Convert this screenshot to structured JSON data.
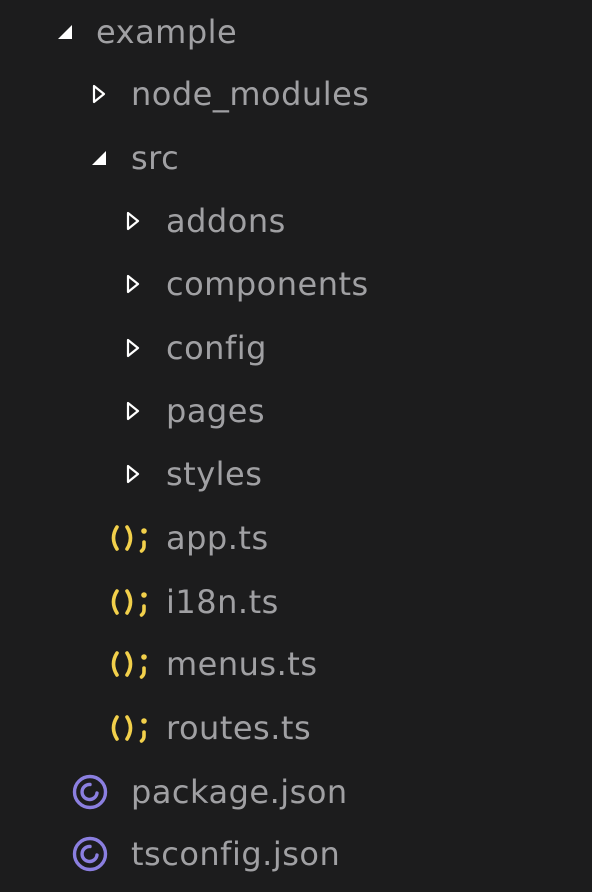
{
  "explorer": {
    "root": {
      "label": "example",
      "expanded": true
    },
    "node_modules": {
      "label": "node_modules",
      "expanded": false
    },
    "src": {
      "label": "src",
      "expanded": true,
      "folders": [
        {
          "label": "addons",
          "expanded": false
        },
        {
          "label": "components",
          "expanded": false
        },
        {
          "label": "config",
          "expanded": false
        },
        {
          "label": "pages",
          "expanded": false
        },
        {
          "label": "styles",
          "expanded": false
        }
      ],
      "files": [
        {
          "label": "app.ts",
          "icon": "typescript-file-icon"
        },
        {
          "label": "i18n.ts",
          "icon": "typescript-file-icon"
        },
        {
          "label": "menus.ts",
          "icon": "typescript-file-icon"
        },
        {
          "label": "routes.ts",
          "icon": "typescript-file-icon"
        }
      ]
    },
    "root_files": [
      {
        "label": "package.json",
        "icon": "json-file-icon"
      },
      {
        "label": "tsconfig.json",
        "icon": "json-file-icon"
      }
    ]
  },
  "colors": {
    "background": "#1c1c1d",
    "text": "#a0a0a3",
    "chevron": "#ffffff",
    "ts_icon": "#f2d04b",
    "json_icon": "#8b7fe0"
  }
}
